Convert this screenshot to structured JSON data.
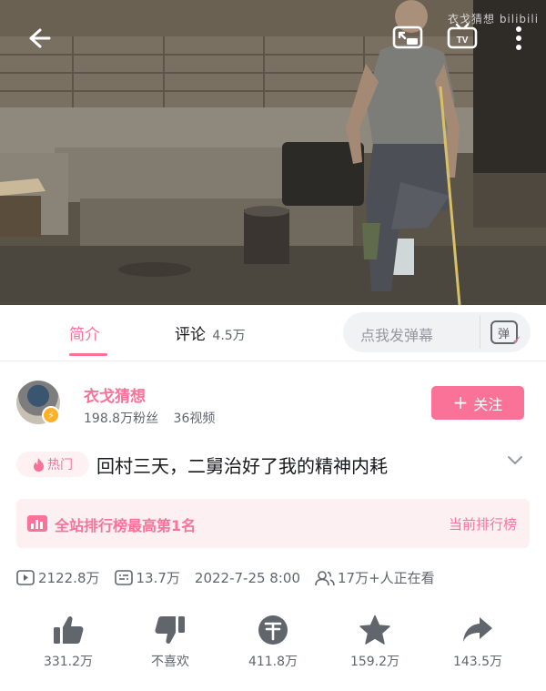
{
  "video": {
    "watermark": "衣戈猜想 bilibili"
  },
  "tabs": {
    "intro": "简介",
    "comments": "评论",
    "comments_count": "4.5万",
    "danmaku_placeholder": "点我发弹幕",
    "danmaku_icon_text": "弹"
  },
  "uploader": {
    "name": "衣戈猜想",
    "followers": "198.8万粉丝",
    "videos": "36视频",
    "follow_label": "关注"
  },
  "title": {
    "hot_tag": "热门",
    "text": "回村三天，二舅治好了我的精神内耗"
  },
  "ranking": {
    "text": "全站排行榜最高第1名",
    "link": "当前排行榜"
  },
  "meta": {
    "plays": "2122.8万",
    "danmaku": "13.7万",
    "date": "2022-7-25 8:00",
    "watching": "17万+人正在看"
  },
  "actions": {
    "like": "331.2万",
    "dislike": "不喜欢",
    "coin": "411.8万",
    "favorite": "159.2万",
    "share": "143.5万"
  },
  "colors": {
    "accent": "#fb7299",
    "text_secondary": "#61666d"
  }
}
